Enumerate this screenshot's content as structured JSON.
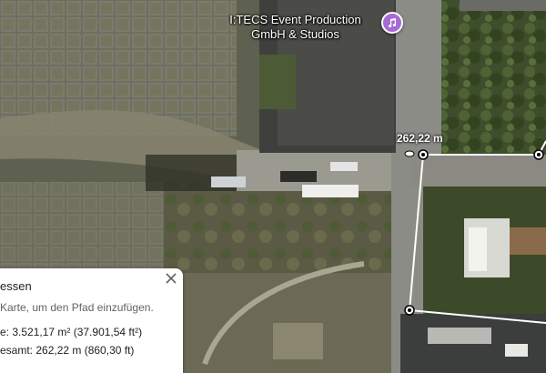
{
  "map": {
    "view": "satellite",
    "poi": {
      "name_line1": "I:TECS Event Production",
      "name_line2": "GmbH & Studios",
      "icon": "music-note-icon",
      "pin_color": "#a86ad6"
    },
    "measure_line_color": "#ffffff",
    "segment_distance": "262,22 m"
  },
  "measure_panel": {
    "title": "essen",
    "hint": "Karte, um den Pfad einzufügen.",
    "area_line": "e: 3.521,17 m² (37.901,54 ft²)",
    "total_line": "esamt: 262,22 m (860,30 ft)",
    "close_icon": "close-icon"
  }
}
